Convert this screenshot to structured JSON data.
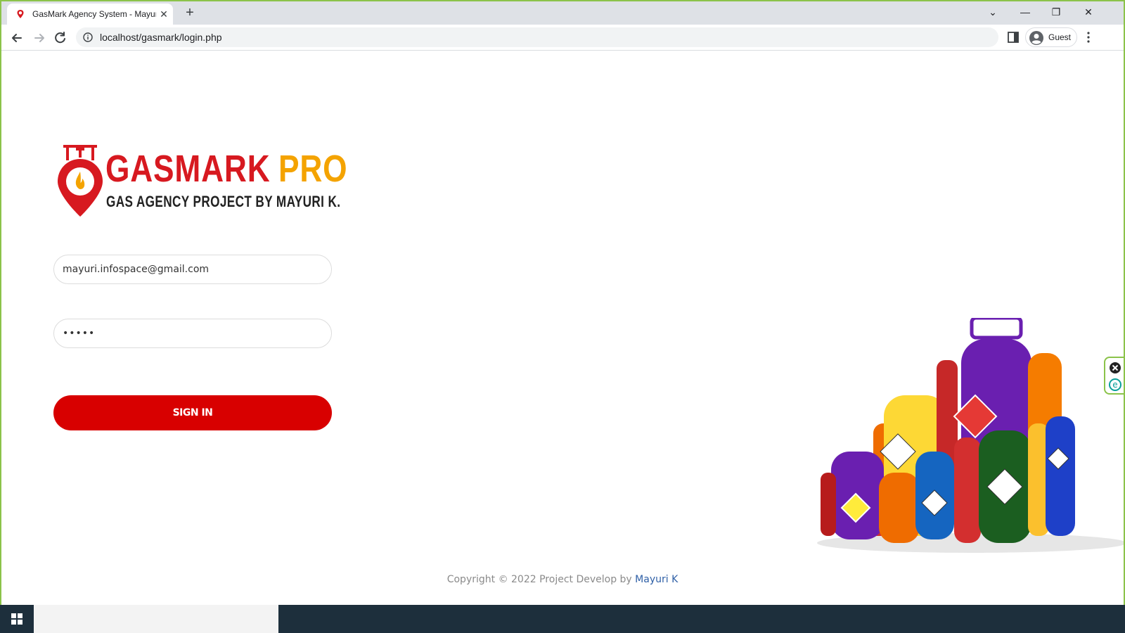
{
  "browser": {
    "tab_title": "GasMark Agency System - Mayuri",
    "tab_close": "✕",
    "new_tab": "+",
    "url": "localhost/gasmark/login.php",
    "profile_label": "Guest",
    "controls": {
      "minimize": "—",
      "restore": "❐",
      "close": "✕",
      "tab_search": "⌄"
    }
  },
  "logo": {
    "title_word1": "GASMARK",
    "title_word2": "PRO",
    "subtitle": "GAS AGENCY PROJECT BY MAYURI K."
  },
  "login": {
    "email_value": "mayuri.infospace@gmail.com",
    "password_value": "•••••",
    "signin_label": "SIGN IN"
  },
  "footer": {
    "text": "Copyright © 2022 Project Develop by ",
    "author": "Mayuri K"
  },
  "colors": {
    "brand_red": "#d80000",
    "brand_orange": "#f4a300",
    "window_border": "#8bc34a",
    "taskbar": "#1d2f3c"
  },
  "icons": [
    "favicon-pin-icon",
    "back-icon",
    "forward-icon",
    "reload-icon",
    "info-icon",
    "side-panel-icon",
    "guest-avatar-icon",
    "menu-icon",
    "windows-start-icon"
  ]
}
